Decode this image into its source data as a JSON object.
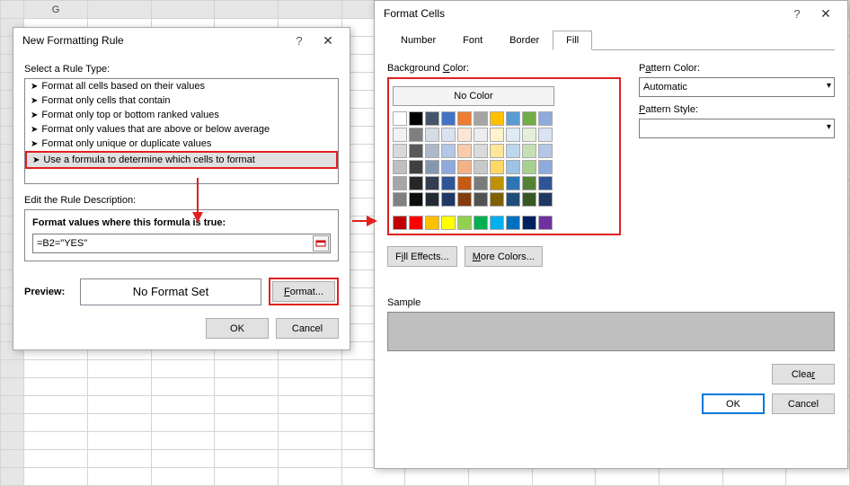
{
  "dlg1": {
    "title": "New Formatting Rule",
    "select_label": "Select a Rule Type:",
    "rules": [
      "Format all cells based on their values",
      "Format only cells that contain",
      "Format only top or bottom ranked values",
      "Format only values that are above or below average",
      "Format only unique or duplicate values",
      "Use a formula to determine which cells to format"
    ],
    "edit_label": "Edit the Rule Description:",
    "formula_label": "Format values where this formula is true:",
    "formula_value": "=B2=\"YES\"",
    "preview_label": "Preview:",
    "preview_text": "No Format Set",
    "format_btn": "Format...",
    "ok": "OK",
    "cancel": "Cancel"
  },
  "dlg2": {
    "title": "Format Cells",
    "tabs": [
      "Number",
      "Font",
      "Border",
      "Fill"
    ],
    "active_tab": "Fill",
    "bg_label": "Background Color:",
    "nocolor": "No Color",
    "pattern_color_label": "Pattern Color:",
    "pattern_color_value": "Automatic",
    "pattern_style_label": "Pattern Style:",
    "fill_effects": "Fill Effects...",
    "more_colors": "More Colors...",
    "sample": "Sample",
    "clear": "Clear",
    "ok": "OK",
    "cancel": "Cancel"
  },
  "grid": {
    "col": "G"
  },
  "palette_theme": [
    [
      "#ffffff",
      "#000000",
      "#44546a",
      "#4472c4",
      "#ed7d31",
      "#a5a5a5",
      "#ffc000",
      "#5b9bd5",
      "#70ad47",
      "#8faadc"
    ],
    [
      "#f2f2f2",
      "#7f7f7f",
      "#d6dce5",
      "#d9e2f3",
      "#fbe5d6",
      "#ededed",
      "#fff2cc",
      "#deebf7",
      "#e2f0d9",
      "#dae3f3"
    ],
    [
      "#d9d9d9",
      "#595959",
      "#adb9ca",
      "#b4c7e7",
      "#f7cbac",
      "#dbdbdb",
      "#ffe699",
      "#bdd7ee",
      "#c5e0b4",
      "#b4c7e7"
    ],
    [
      "#bfbfbf",
      "#404040",
      "#8497b0",
      "#8faadc",
      "#f4b183",
      "#c9c9c9",
      "#ffd966",
      "#9dc3e6",
      "#a9d18e",
      "#8faadc"
    ],
    [
      "#a6a6a6",
      "#262626",
      "#333f50",
      "#2f5597",
      "#c55a11",
      "#7b7b7b",
      "#bf9000",
      "#2e75b6",
      "#548235",
      "#2f5597"
    ],
    [
      "#808080",
      "#0d0d0d",
      "#222a35",
      "#1f3864",
      "#843c0c",
      "#525252",
      "#806000",
      "#1f4e79",
      "#385723",
      "#1f3864"
    ]
  ],
  "palette_std": [
    "#c00000",
    "#ff0000",
    "#ffc000",
    "#ffff00",
    "#92d050",
    "#00b050",
    "#00b0f0",
    "#0070c0",
    "#002060",
    "#7030a0"
  ]
}
